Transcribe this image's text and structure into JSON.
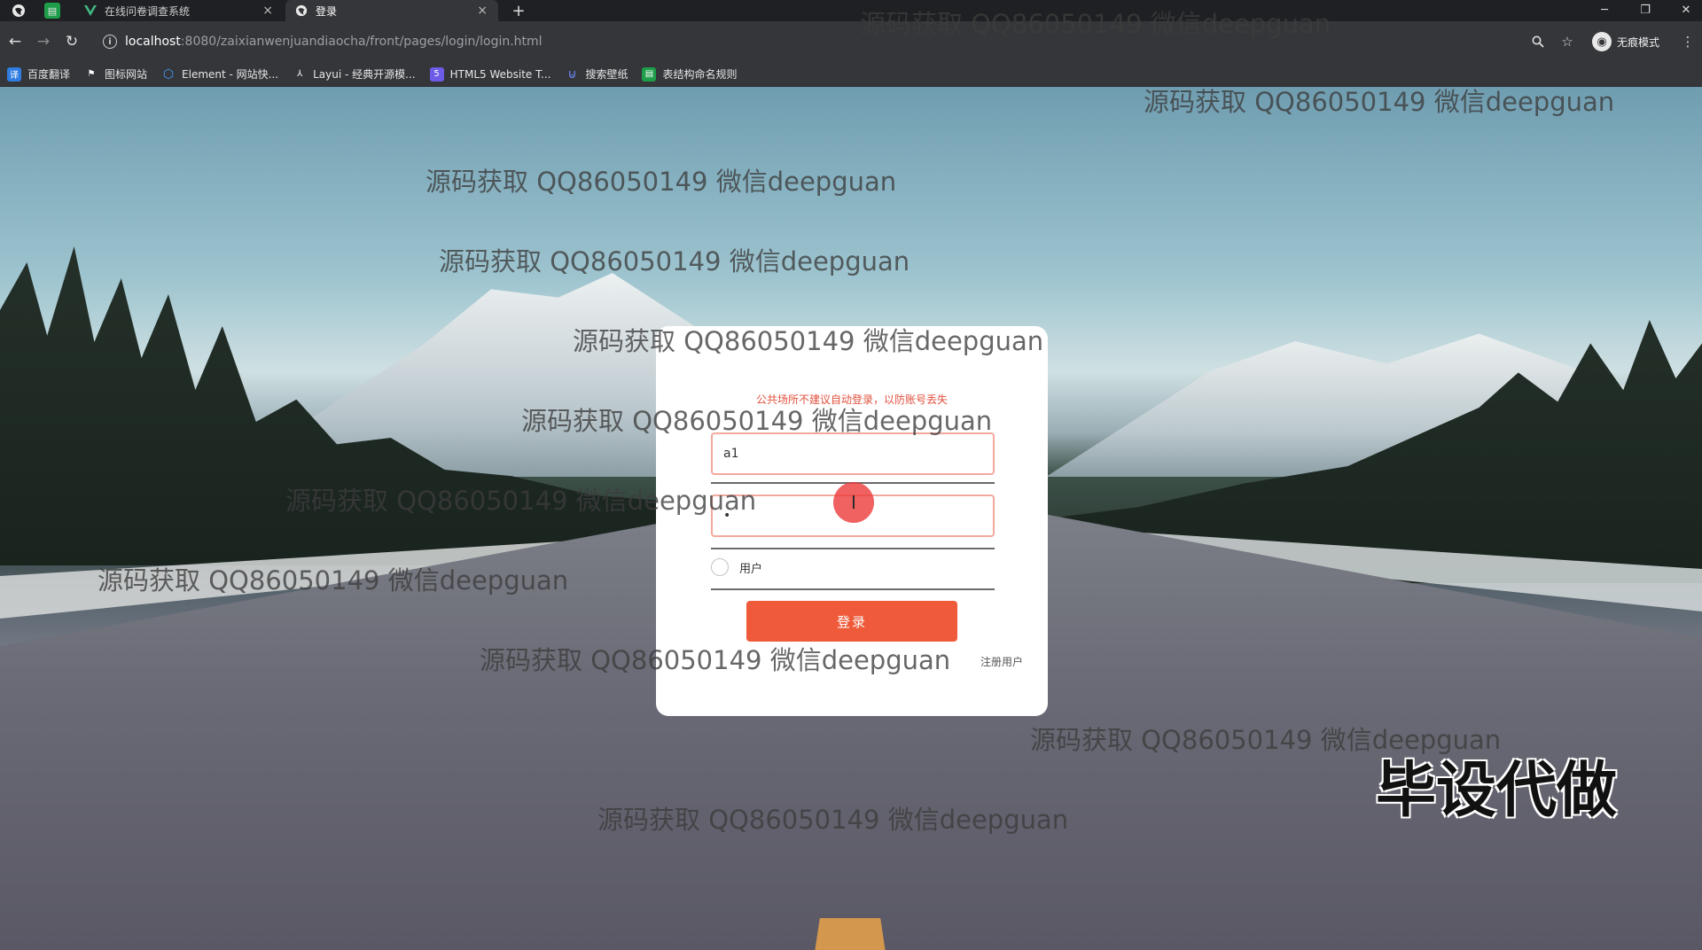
{
  "browser": {
    "tabs": [
      {
        "title": "在线问卷调查系统",
        "icon": "vue-icon",
        "active": false
      },
      {
        "title": "登录",
        "icon": "globe-icon",
        "active": true
      }
    ],
    "new_tab_symbol": "+",
    "close_symbol": "×",
    "url_host": "localhost",
    "url_path": ":8080/zaixianwenjuandiaocha/front/pages/login/login.html",
    "profile_label": "无痕模式",
    "bookmarks": [
      {
        "label": "百度翻译",
        "icon": "translate-icon",
        "color": "#2f7de1"
      },
      {
        "label": "图标网站",
        "icon": "flag-icon",
        "color": "#3a3a3a"
      },
      {
        "label": "Element - 网站快...",
        "icon": "element-icon",
        "color": "#409eff"
      },
      {
        "label": "Layui - 经典开源模...",
        "icon": "layui-icon",
        "color": "#3a3a3a"
      },
      {
        "label": "HTML5 Website T...",
        "icon": "html5-icon",
        "color": "#6c5ce7"
      },
      {
        "label": "搜索壁纸",
        "icon": "wallpaper-icon",
        "color": "#3a5bd9"
      },
      {
        "label": "表结构命名规则",
        "icon": "sheet-icon",
        "color": "#1e9e4a"
      }
    ]
  },
  "watermark_text": "源码获取 QQ86050149 微信deepguan",
  "stamp_text": "毕设代做",
  "login": {
    "tip": "公共场所不建议自动登录，以防账号丢失",
    "username_value": "a1",
    "password_value": "•",
    "role_label": "用户",
    "submit_label": "登录",
    "register_label": "注册用户"
  },
  "colors": {
    "button": "#ef5b3a",
    "tip": "#e2503d",
    "input_border": "#f3a99e",
    "cursor_highlight": "#ec3a3a"
  }
}
